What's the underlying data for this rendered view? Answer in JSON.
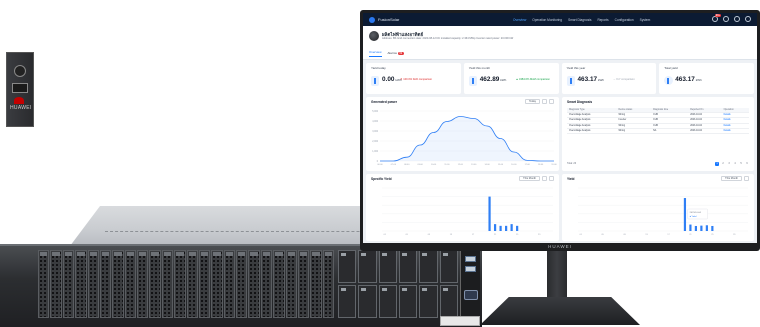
{
  "app": {
    "brand": "FusionSolar",
    "nav": [
      "Overview",
      "Operation Monitoring",
      "Smart Diagnosis",
      "Reports",
      "Configuration",
      "System"
    ],
    "nav_active": 0,
    "notification_count": "99+"
  },
  "plant": {
    "name": "ผลิตไฟฟ้าแสงอาทิตย์",
    "meta": "Address: BS    Grid connection date: 2023-08-12    DC installed capacity: 2.364 MWp    Inverter rated power: 20.000 kW"
  },
  "tabs": [
    {
      "label": "Overview",
      "active": true
    },
    {
      "label": "Alarms",
      "badge": "99"
    }
  ],
  "kpis": [
    {
      "label": "Yield today",
      "value": "0.00",
      "unit": "kWh",
      "delta": "▼ 100.0%  DoD comparison",
      "delta_dir": "down"
    },
    {
      "label": "Yield this month",
      "value": "462.89",
      "unit": "kWh",
      "delta": "▲ 4384.6%  MoM comparison",
      "delta_dir": "up"
    },
    {
      "label": "Yield this year",
      "value": "463.17",
      "unit": "kWh",
      "delta": "-- YoY comparison",
      "delta_dir": "none"
    },
    {
      "label": "Total yield",
      "value": "463.17",
      "unit": "kWh",
      "delta": "",
      "delta_dir": "none"
    }
  ],
  "generated_power": {
    "title": "Generated power",
    "period": "Today",
    "unit": "kW",
    "y_ticks": [
      "5,000",
      "4,000",
      "3,000",
      "2,000",
      "1,000",
      "0"
    ]
  },
  "diagnosis": {
    "title": "Smart Diagnosis",
    "columns": [
      "Diagnosis Type",
      "Device status",
      "Diagnosis time",
      "Reported On",
      "Operation"
    ],
    "rows": [
      [
        "Overvoltage Analysis",
        "Wiring",
        "CUR",
        "2023-10-04",
        "Details"
      ],
      [
        "Overvoltage Analysis",
        "Inverter",
        "CUR",
        "2023-10-04",
        "Details"
      ],
      [
        "Overvoltage Analysis",
        "Wiring",
        "CUR",
        "2023-10-04",
        "Details"
      ],
      [
        "Overvoltage Analysis",
        "Wiring",
        "NA",
        "2023-10-04",
        "Details"
      ]
    ],
    "total": "Total: 26",
    "pages": [
      "1",
      "2",
      "3",
      "4",
      "5",
      "6"
    ],
    "current_page": "1"
  },
  "specific_yield": {
    "title": "Specific Yield",
    "period": "This Month",
    "unit": "kWh/kWp"
  },
  "yield_panel": {
    "title": "Yield",
    "period": "This Month",
    "unit": "kWh",
    "tooltip_date": "2023-10-04",
    "tooltip_value": "Yield"
  },
  "monitor_brand": "HUAWEI",
  "server_brand": "HUAWEI",
  "chart_data": [
    {
      "type": "area",
      "title": "Generated power",
      "x": [
        "06:00",
        "07:00",
        "08:00",
        "09:00",
        "10:00",
        "11:00",
        "12:00",
        "13:00",
        "14:00",
        "15:00",
        "16:00",
        "17:00",
        "18:00",
        "19:00"
      ],
      "values": [
        0,
        0,
        380,
        1600,
        2850,
        3950,
        4450,
        4250,
        3500,
        2250,
        900,
        60,
        0,
        0
      ],
      "ylim": [
        0,
        5000
      ],
      "color": "#2f7ff5"
    },
    {
      "type": "bar",
      "title": "Specific Yield",
      "categories": [
        "01",
        "02",
        "03",
        "04",
        "05",
        "06",
        "07",
        "08",
        "09",
        "10",
        "11",
        "12",
        "13",
        "14",
        "15",
        "16",
        "17",
        "18",
        "19",
        "20",
        "21",
        "22",
        "23",
        "24",
        "25",
        "26",
        "27",
        "28",
        "29",
        "30",
        "31"
      ],
      "values": [
        0,
        0,
        0,
        0,
        0,
        0,
        0,
        0,
        0,
        0,
        0,
        0,
        0,
        0,
        0,
        0,
        0,
        0,
        0,
        0.2,
        0.04,
        0.03,
        0.03,
        0.04,
        0.03,
        0,
        0,
        0,
        0,
        0,
        0
      ],
      "ylim": [
        0,
        0.25
      ],
      "color": "#2f7ff5"
    },
    {
      "type": "bar",
      "title": "Yield",
      "categories": [
        "01",
        "02",
        "03",
        "04",
        "05",
        "06",
        "07",
        "08",
        "09",
        "10",
        "11",
        "12",
        "13",
        "14",
        "15",
        "16",
        "17",
        "18",
        "19",
        "20",
        "21",
        "22",
        "23",
        "24",
        "25",
        "26",
        "27",
        "28",
        "29",
        "30",
        "31"
      ],
      "values": [
        0,
        0,
        0,
        0,
        0,
        0,
        0,
        0,
        0,
        0,
        0,
        0,
        0,
        0,
        0,
        0,
        0,
        0,
        0,
        460,
        90,
        70,
        75,
        80,
        70,
        0,
        0,
        0,
        0,
        0,
        0
      ],
      "ylim": [
        0,
        600
      ],
      "color": "#2f7ff5"
    }
  ]
}
